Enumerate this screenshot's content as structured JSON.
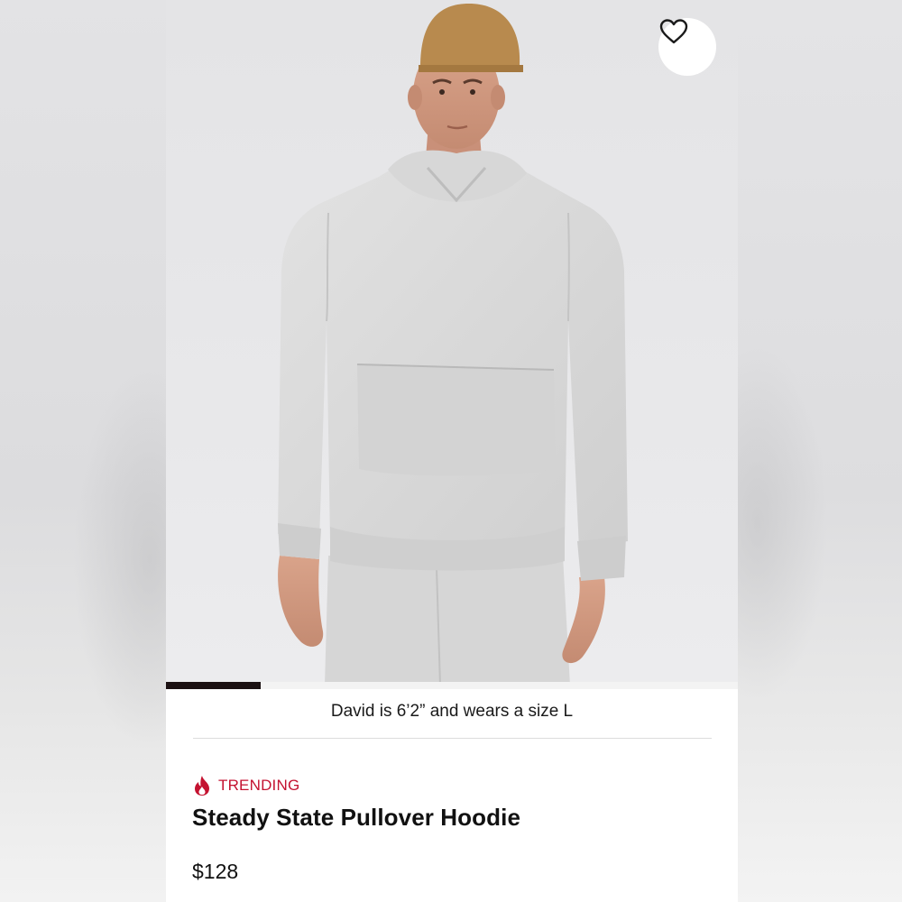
{
  "product": {
    "image_alt": "Model wearing a heather grey pullover hoodie, matching joggers and a tan cap",
    "model_caption": "David is 6’2” and wears a size L",
    "badge_label": "TRENDING",
    "name": "Steady State Pullover Hoodie",
    "price": "$128"
  },
  "gallery": {
    "progress_fraction": 0.166
  },
  "icons": {
    "favorite": "heart-outline-icon",
    "trending": "flame-icon"
  },
  "colors": {
    "accent": "#c41230",
    "text": "#111111",
    "progress": "#1b1112"
  }
}
